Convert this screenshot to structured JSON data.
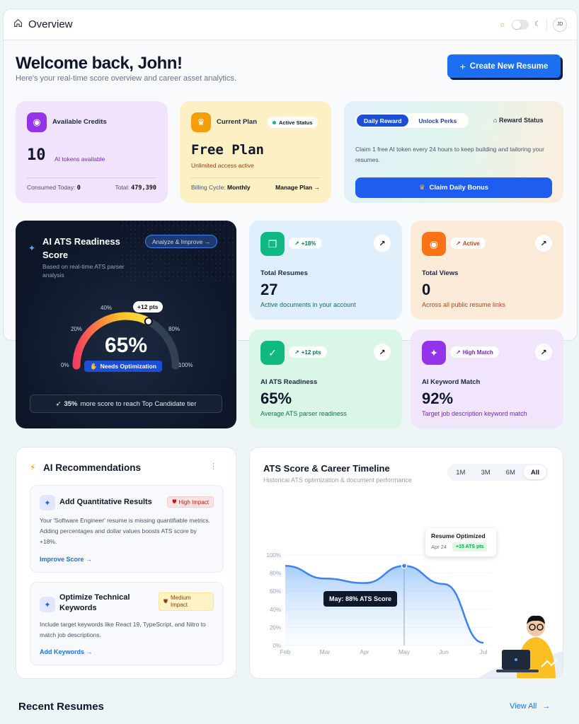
{
  "header": {
    "title": "Overview",
    "avatar_initials": "JD"
  },
  "welcome": {
    "title": "Welcome back, John!",
    "subtitle": "Here's your real-time score overview and career asset analytics."
  },
  "create_button": "Create New Resume",
  "credits": {
    "label": "Available Credits",
    "value": "10",
    "unit": "AI tokens available",
    "consumed_label": "Consumed Today:",
    "consumed_value": "0",
    "total_label": "Total:",
    "total_value": "479,390"
  },
  "plan": {
    "label": "Current Plan",
    "status": "Active Status",
    "name": "Free Plan",
    "desc": "Unlimited access active",
    "billing_label": "Billing Cycle:",
    "billing_value": "Monthly",
    "manage": "Manage Plan"
  },
  "reward": {
    "tab_active": "Daily Reward",
    "tab_inactive": "Unlock Perks",
    "status": "Reward Status",
    "desc": "Claim 1 free AI token every 24 hours to keep building and tailoring your resumes.",
    "claim": "Claim Daily Bonus"
  },
  "ats_card": {
    "title": "AI ATS Readiness Score",
    "subtitle": "Based on real-time ATS parser analysis",
    "analyze": "Analyze & Improve",
    "score": "65%",
    "delta": "+12 pts",
    "status": "Needs Optimization",
    "score_value": 65,
    "ticks": [
      "0%",
      "20%",
      "40%",
      "80%",
      "100%"
    ],
    "footer_bold": "35%",
    "footer_rest": "more score to reach Top Candidate tier"
  },
  "stats": [
    {
      "badge": "+18%",
      "title": "Total Resumes",
      "value": "27",
      "desc": "Active documents in your account",
      "color": "#059669"
    },
    {
      "badge": "Active",
      "title": "Total Views",
      "value": "0",
      "desc": "Across all public resume links",
      "color": "#ea580c"
    },
    {
      "badge": "+12 pts",
      "title": "AI ATS Readiness",
      "value": "65%",
      "desc": "Average ATS parser readiness",
      "color": "#059669"
    },
    {
      "badge": "High Match",
      "title": "AI Keyword Match",
      "value": "92%",
      "desc": "Target job description keyword match",
      "color": "#7c3aed"
    }
  ],
  "recommendations": {
    "title": "AI Recommendations",
    "items": [
      {
        "title": "Add Quantitative Results",
        "impact": "High Impact",
        "desc": "Your 'Software Engineer' resume is missing quantifiable metrics. Adding percentages and dollar values boosts ATS score by +18%.",
        "action": "Improve Score"
      },
      {
        "title": "Optimize Technical Keywords",
        "impact": "Medium Impact",
        "desc": "Include target keywords like React 19, TypeScript, and Nitro to match job descriptions.",
        "action": "Add Keywords"
      }
    ]
  },
  "timeline": {
    "title": "ATS Score & Career Timeline",
    "subtitle": "Historical ATS optimization & document performance",
    "tabs": [
      "1M",
      "3M",
      "6M",
      "All"
    ],
    "active_tab": "All",
    "tooltip_title": "Resume Optimized",
    "tooltip_date": "Apr 24",
    "tooltip_badge": "+15 ATS pts",
    "hover_label": "May: 88% ATS Score"
  },
  "chart_data": {
    "type": "area",
    "x": [
      "Feb",
      "Mar",
      "Apr",
      "May",
      "Jun",
      "Jul"
    ],
    "series": [
      {
        "values": [
          88,
          74,
          69,
          88,
          68,
          3
        ]
      }
    ],
    "yticks": [
      "0%",
      "20%",
      "40%",
      "60%",
      "80%",
      "100%"
    ],
    "ylim": [
      0,
      100
    ],
    "color": "#3b82f6"
  },
  "recent": {
    "title": "Recent Resumes",
    "view_all": "View All"
  }
}
